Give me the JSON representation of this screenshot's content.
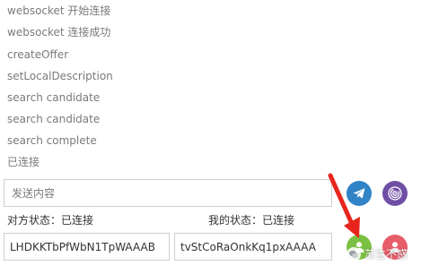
{
  "log": [
    "websocket 开始连接",
    "websocket 连接成功",
    "createOffer",
    "setLocalDescription",
    "search candidate",
    "search candidate",
    "search complete",
    "已连接"
  ],
  "message_input": {
    "placeholder": "发送内容",
    "value": ""
  },
  "buttons": {
    "send": {
      "icon": "paper-plane-icon",
      "color": "#2f83c6"
    },
    "share": {
      "icon": "fingerprint-icon",
      "color": "#6f4fa6"
    },
    "call": {
      "icon": "user-call-icon",
      "color": "#7cc143"
    },
    "hangup": {
      "icon": "user-hangup-icon",
      "color": "#e85d6a"
    }
  },
  "peer_status": "对方状态：已连接",
  "my_status": "我的状态：已连接",
  "peer_id": "LHDKKTbPfWbN1TpWAAAB",
  "my_id": "tvStCoRaOnkKq1pxAAAA",
  "annotation": {
    "color": "#e8251d"
  },
  "watermark": {
    "text": "苏生不惑"
  }
}
